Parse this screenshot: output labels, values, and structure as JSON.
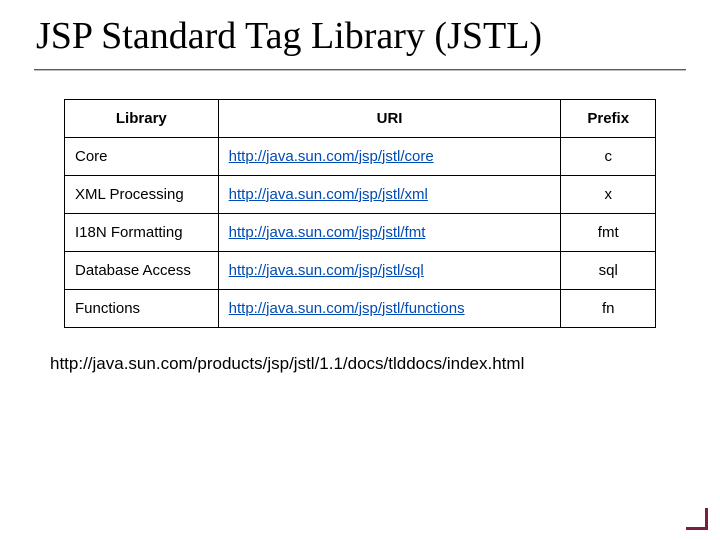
{
  "title": "JSP Standard Tag Library (JSTL)",
  "table": {
    "headers": {
      "library": "Library",
      "uri": "URI",
      "prefix": "Prefix"
    },
    "rows": [
      {
        "library": "Core",
        "uri": "http://java.sun.com/jsp/jstl/core",
        "prefix": "c"
      },
      {
        "library": "XML Processing",
        "uri": "http://java.sun.com/jsp/jstl/xml",
        "prefix": "x"
      },
      {
        "library": "I18N Formatting",
        "uri": "http://java.sun.com/jsp/jstl/fmt",
        "prefix": "fmt"
      },
      {
        "library": "Database Access",
        "uri": "http://java.sun.com/jsp/jstl/sql",
        "prefix": "sql"
      },
      {
        "library": "Functions",
        "uri": "http://java.sun.com/jsp/jstl/functions",
        "prefix": "fn"
      }
    ]
  },
  "footer_link": "http://java.sun.com/products/jsp/jstl/1.1/docs/tlddocs/index.html"
}
